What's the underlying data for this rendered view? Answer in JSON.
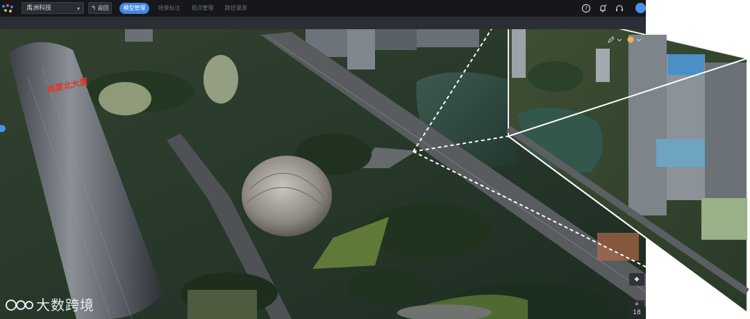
{
  "header": {
    "project_name": "禹洲科技",
    "back_label": "返回",
    "tabs": [
      {
        "label": "模型管理",
        "active": true
      },
      {
        "label": "场景标注",
        "active": false
      },
      {
        "label": "视点管理",
        "active": false
      },
      {
        "label": "路径漫游",
        "active": false
      }
    ]
  },
  "scene": {
    "tower_sign": "岗厦北大厦",
    "zoom_in_label": "+",
    "zoom_value": "18"
  },
  "watermark": {
    "text": "大数跨境"
  },
  "colors": {
    "accent": "#3f87e6",
    "topbar": "#15171b",
    "subbar": "#2b2f35"
  }
}
